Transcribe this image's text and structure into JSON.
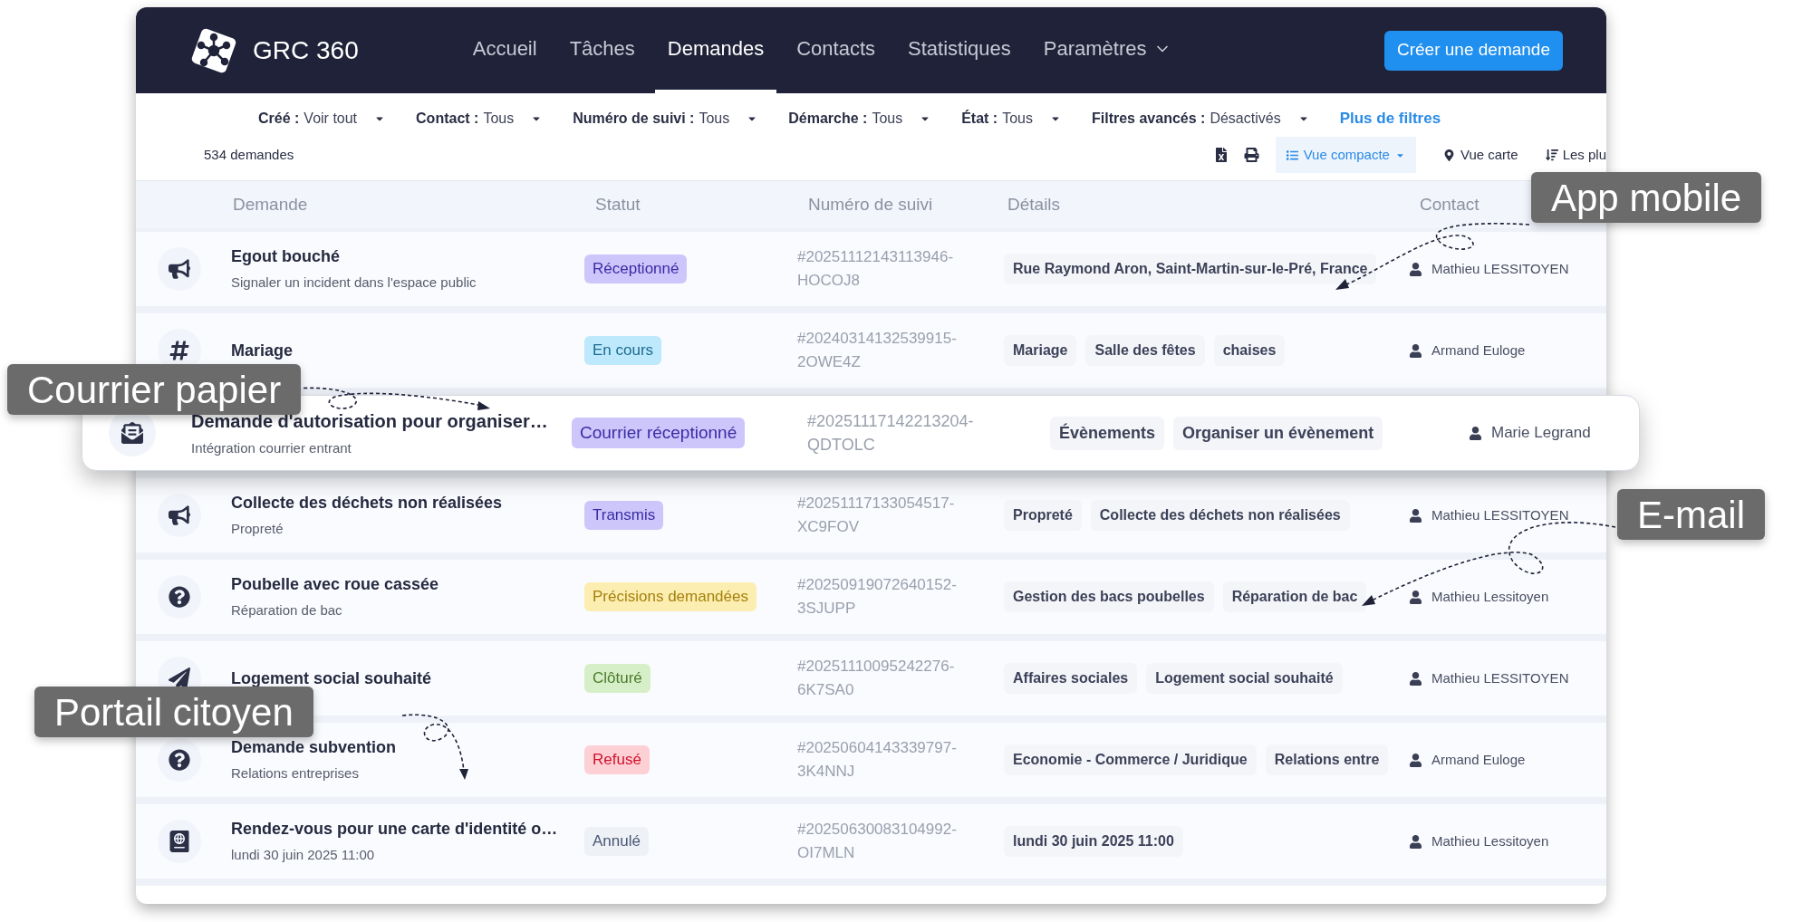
{
  "app": {
    "brand": "GRC 360"
  },
  "nav": [
    {
      "label": "Accueil",
      "selected": false,
      "menu": false
    },
    {
      "label": "Tâches",
      "selected": false,
      "menu": false
    },
    {
      "label": "Demandes",
      "selected": true,
      "menu": false
    },
    {
      "label": "Contacts",
      "selected": false,
      "menu": false
    },
    {
      "label": "Statistiques",
      "selected": false,
      "menu": false
    },
    {
      "label": "Paramètres",
      "selected": false,
      "menu": true
    }
  ],
  "create_button": "Créer une demande",
  "filters": [
    {
      "label": "Créé :",
      "value": "Voir tout"
    },
    {
      "label": "Contact :",
      "value": "Tous"
    },
    {
      "label": "Numéro de suivi :",
      "value": "Tous"
    },
    {
      "label": "Démarche :",
      "value": "Tous"
    },
    {
      "label": "État :",
      "value": "Tous"
    },
    {
      "label": "Filtres avancés :",
      "value": "Désactivés"
    }
  ],
  "more_filters": "Plus de filtres",
  "count": "534 demandes",
  "toolbar": [
    {
      "kind": "excel"
    },
    {
      "kind": "print"
    },
    {
      "kind": "view",
      "label": "Vue compacte",
      "selected": true
    },
    {
      "kind": "map",
      "label": "Vue carte",
      "selected": false
    },
    {
      "kind": "sort",
      "label": "Les plu"
    }
  ],
  "table": {
    "columns": [
      "Demande",
      "Statut",
      "Numéro de suivi",
      "Détails",
      "Contact"
    ],
    "rows": [
      {
        "kind": "megaphone",
        "highlighted": false,
        "title": "Egout bouché",
        "subtitle": "Signaler un incident dans l'espace public",
        "status": {
          "label": "Réceptionné",
          "color": "#cdc6fb"
        },
        "number": "#20251112143113946-HOCOJ8",
        "details": [
          "Rue Raymond Aron, Saint-Martin-sur-le-Pré, France"
        ],
        "contact": "Mathieu LESSITOYEN"
      },
      {
        "kind": "hashtag",
        "highlighted": false,
        "title": "Mariage",
        "status": {
          "label": "En cours",
          "color": "#bee8fb"
        },
        "number": "#20240314132539915-2OWE4Z",
        "details": [
          "Mariage",
          "Salle des fêtes",
          "chaises"
        ],
        "contact": "Armand Euloge"
      },
      {
        "kind": "mail",
        "highlighted": true,
        "title": "Demande d'autorisation pour organiser…",
        "subtitle": "Intégration courrier entrant",
        "status": {
          "label": "Courrier réceptionné",
          "color": "#cdc6fb"
        },
        "number": "#20251117142213204-QDTOLC",
        "details": [
          "Évènements",
          "Organiser un évènement"
        ],
        "contact": "Marie Legrand"
      },
      {
        "kind": "megaphone",
        "highlighted": false,
        "title": "Collecte des déchets non réalisées",
        "subtitle": "Propreté",
        "status": {
          "label": "Transmis",
          "color": "#cdc6fb"
        },
        "number": "#20251117133054517-XC9FOV",
        "details": [
          "Propreté",
          "Collecte des déchets non réalisées"
        ],
        "contact": "Mathieu LESSITOYEN"
      },
      {
        "kind": "question",
        "highlighted": false,
        "title": "Poubelle avec roue cassée",
        "subtitle": "Réparation de bac",
        "status": {
          "label": "Précisions demandées",
          "color": "#fcedb0"
        },
        "number": "#20250919072640152-3SJUPP",
        "details": [
          "Gestion des bacs poubelles",
          "Réparation de bac"
        ],
        "contact": "Mathieu Lessitoyen"
      },
      {
        "kind": "send",
        "highlighted": false,
        "title": "Logement social souhaité",
        "status": {
          "label": "Clôturé",
          "color": "#d7efc8"
        },
        "number": "#20251110095242276-6K7SA0",
        "details": [
          "Affaires sociales",
          "Logement social souhaité"
        ],
        "contact": "Mathieu LESSITOYEN"
      },
      {
        "kind": "question",
        "highlighted": false,
        "title": "Demande subvention",
        "subtitle": "Relations entreprises",
        "status": {
          "label": "Refusé",
          "color": "#fdd0d6"
        },
        "number": "#20250604143339797-3K4NNJ",
        "details": [
          "Economie - Commerce / Juridique",
          "Relations entre"
        ],
        "contact": "Armand Euloge"
      },
      {
        "kind": "passport",
        "highlighted": false,
        "title": "Rendez-vous pour une carte d'identité o…",
        "subtitle": "lundi 30 juin 2025 11:00",
        "status": {
          "label": "Annulé",
          "color": "#eef1f6"
        },
        "number": "#20250630083104992-OI7MLN",
        "details": [
          "lundi 30 juin 2025 11:00"
        ],
        "contact": "Mathieu Lessitoyen"
      }
    ]
  },
  "callouts": [
    {
      "label": "App mobile"
    },
    {
      "label": "Courrier papier"
    },
    {
      "label": "E-mail"
    },
    {
      "label": "Portail citoyen"
    }
  ]
}
